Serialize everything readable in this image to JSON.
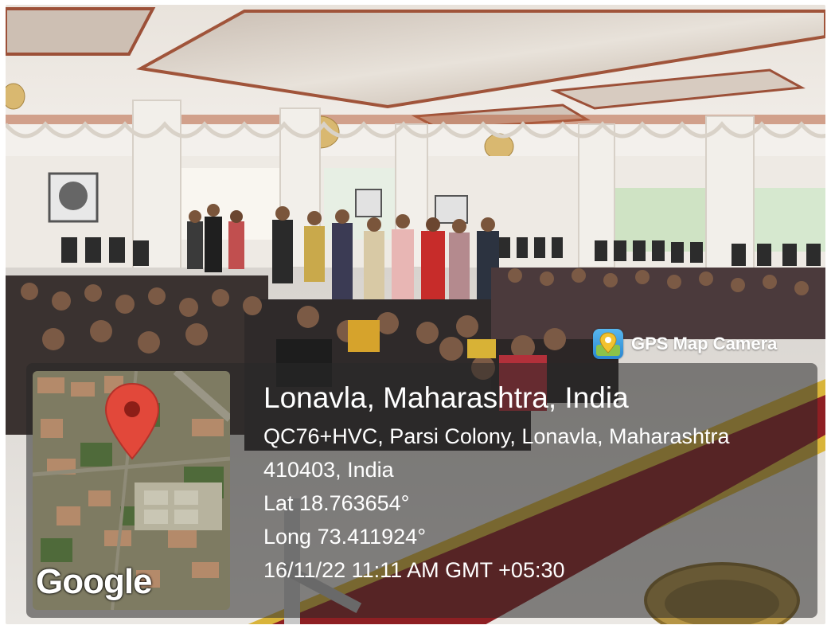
{
  "overlay": {
    "app_name": "GPS Map Camera",
    "app_icon": "map-pin-app-icon",
    "location_title": "Lonavla, Maharashtra, India",
    "address_line1": "QC76+HVC, Parsi Colony, Lonavla, Maharashtra",
    "address_line2": "410403, India",
    "latitude": "Lat 18.763654°",
    "longitude": "Long 73.411924°",
    "datetime": "16/11/22 11:11 AM GMT +05:30"
  },
  "map": {
    "provider_label": "Google",
    "pin_icon": "location-pin-icon",
    "pin_color": "#e2483a"
  },
  "colors": {
    "panel": "rgba(40,40,40,0.55)",
    "carpet_red": "#8e1f23",
    "carpet_border": "#d9b43a"
  }
}
